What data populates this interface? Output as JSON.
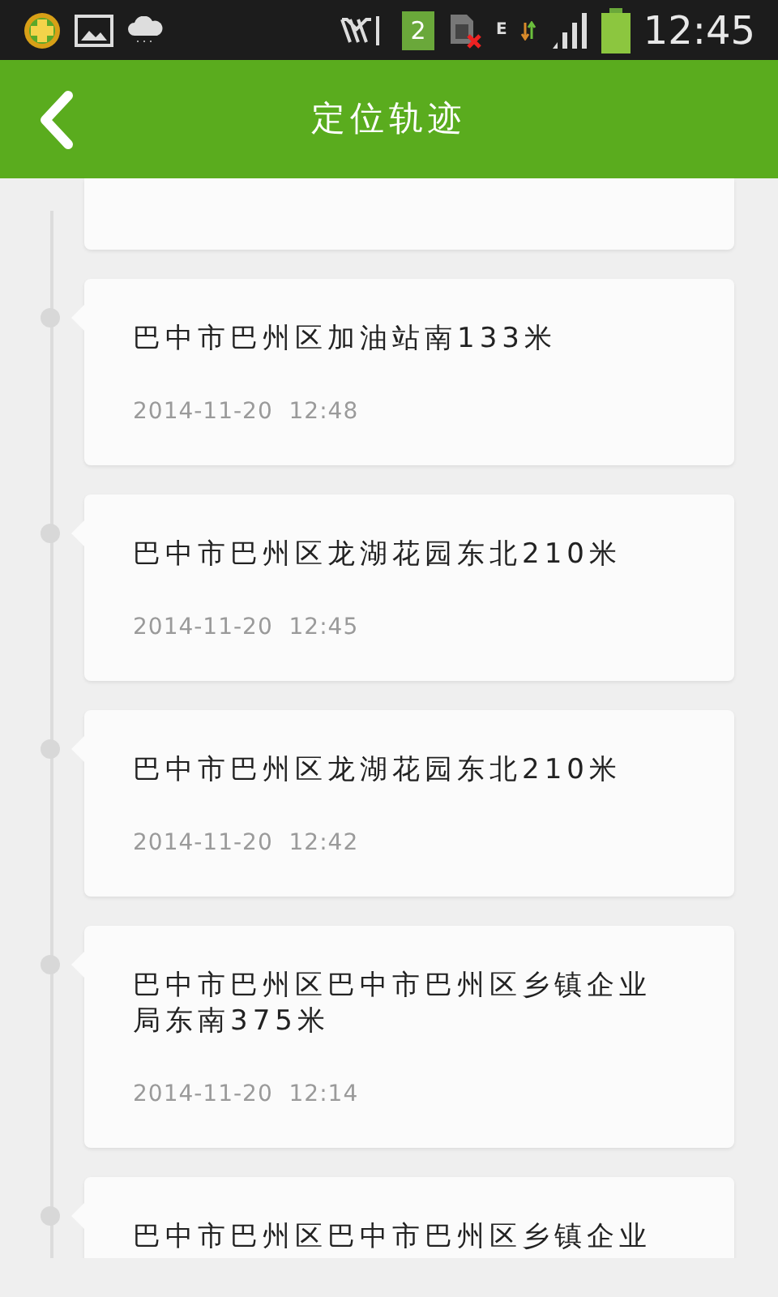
{
  "status_bar": {
    "sim_slot": "2",
    "network_type": "E",
    "time": "12:45"
  },
  "app_bar": {
    "title": "定位轨迹"
  },
  "track": [
    {
      "kind": "partial"
    },
    {
      "kind": "full",
      "address": "巴中市巴州区加油站南133米",
      "time": "2014-11-20  12:48"
    },
    {
      "kind": "full",
      "address": "巴中市巴州区龙湖花园东北210米",
      "time": "2014-11-20  12:45"
    },
    {
      "kind": "full",
      "address": "巴中市巴州区龙湖花园东北210米",
      "time": "2014-11-20  12:42"
    },
    {
      "kind": "full",
      "address": "巴中市巴州区巴中市巴州区乡镇企业局东南375米",
      "time": "2014-11-20  12:14"
    },
    {
      "kind": "cut",
      "address": "巴中市巴州区巴中市巴州区乡镇企业"
    }
  ]
}
